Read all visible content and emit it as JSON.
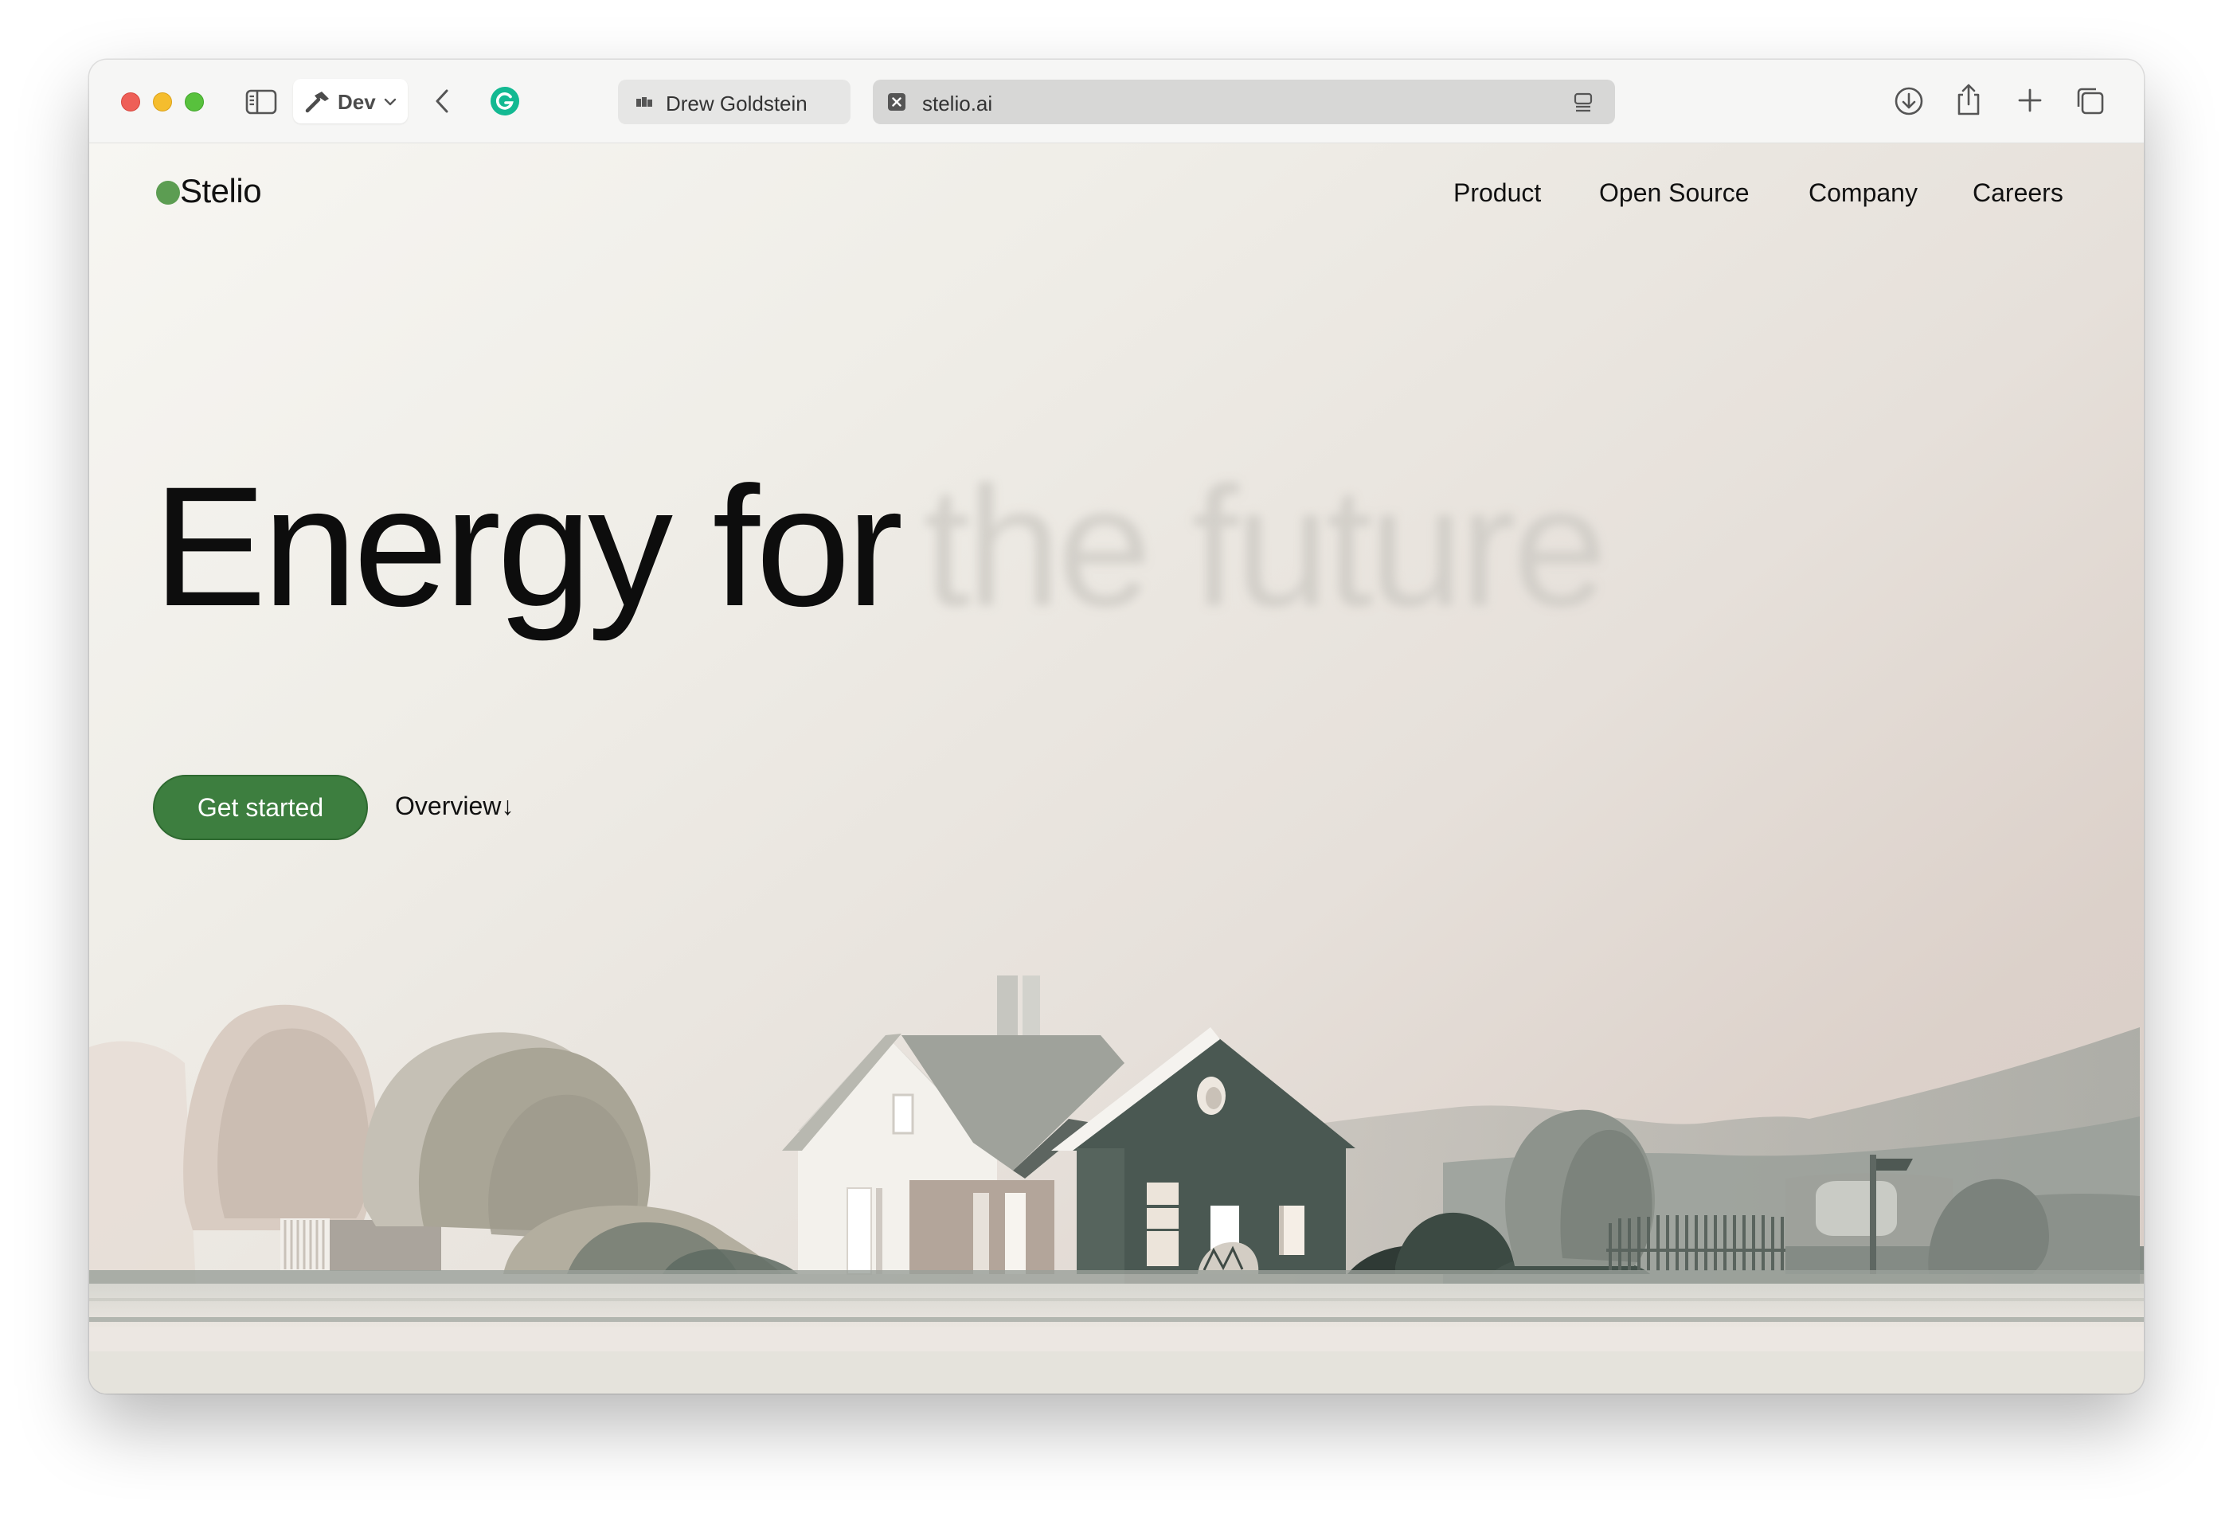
{
  "browser": {
    "dev_label": "Dev",
    "tabs": [
      {
        "label": "Drew Goldstein",
        "active": false
      },
      {
        "label": "stelio.ai",
        "active": true
      }
    ],
    "icons": [
      "sidebar-icon",
      "hammer-icon",
      "chevron-down-icon",
      "back-icon",
      "grammarly-icon",
      "download-icon",
      "share-icon",
      "new-tab-icon",
      "tab-overview-icon"
    ]
  },
  "site": {
    "logo_text": "Stelio",
    "nav": {
      "product": "Product",
      "open_source": "Open Source",
      "company": "Company",
      "careers": "Careers"
    },
    "hero": {
      "headline_primary": "Energy for",
      "headline_faded": "the future"
    },
    "cta": {
      "primary": "Get started",
      "secondary": "Overview↓"
    }
  },
  "colors": {
    "brand_green": "#3d7e3f",
    "logo_dot": "#5c9d52",
    "house_dark": "#4a5852",
    "background_warm": "#efede7"
  }
}
